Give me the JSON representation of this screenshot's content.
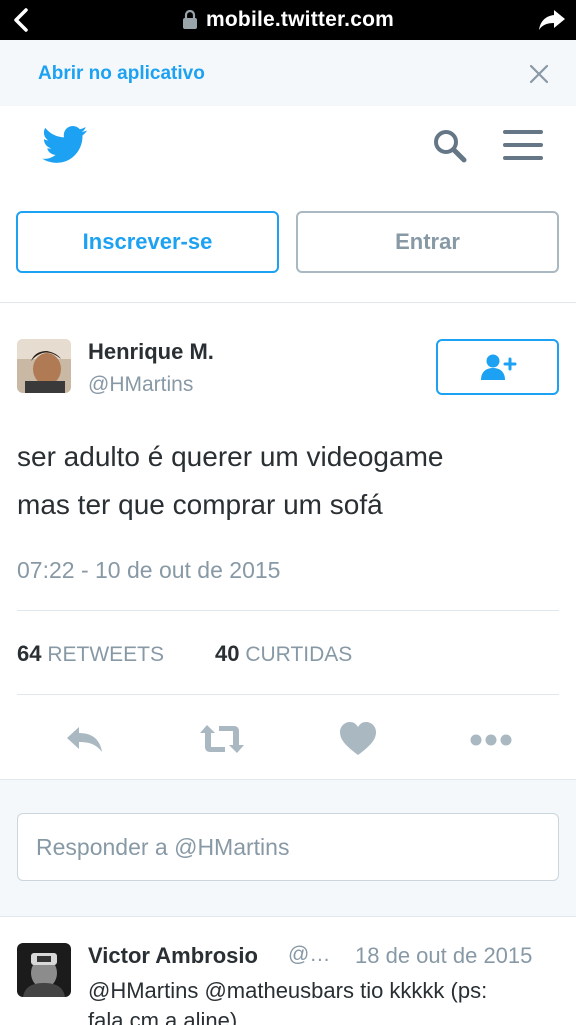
{
  "browser": {
    "url": "mobile.twitter.com",
    "icons": [
      "back-chevron-icon",
      "lock-icon",
      "share-icon"
    ]
  },
  "banner": {
    "open_app_label": "Abrir no aplicativo",
    "close_icon": "close-icon"
  },
  "header": {
    "icons": [
      "twitter-bird-icon",
      "search-icon",
      "hamburger-menu-icon"
    ],
    "signup_label": "Inscrever-se",
    "login_label": "Entrar"
  },
  "tweet": {
    "author_name": "Henrique M.",
    "author_handle": "@HMartins",
    "text_line1": "ser adulto é querer um videogame",
    "text_line2": "mas ter que comprar um sofá",
    "timestamp": "07:22 - 10 de out de 2015",
    "retweets_count": "64",
    "retweets_label": "RETWEETS",
    "likes_count": "40",
    "likes_label": "CURTIDAS",
    "follow_icon": "follow-user-icon",
    "action_icons": [
      "reply-icon",
      "retweet-icon",
      "heart-icon",
      "more-icon"
    ]
  },
  "reply_box": {
    "placeholder": "Responder a @HMartins"
  },
  "reply_tweet": {
    "author_name": "Victor Ambrosio",
    "author_handle": "@…",
    "date": "18 de out de 2015",
    "text_line1": "@HMartins @matheusbars tio kkkkk (ps:",
    "text_line2": "fala cm a aline)"
  },
  "colors": {
    "twitter_blue": "#1da1f2",
    "text_dark": "#292f33",
    "text_gray": "#8899a6",
    "border": "#e1e8ed",
    "background": "#f5f8fa"
  }
}
